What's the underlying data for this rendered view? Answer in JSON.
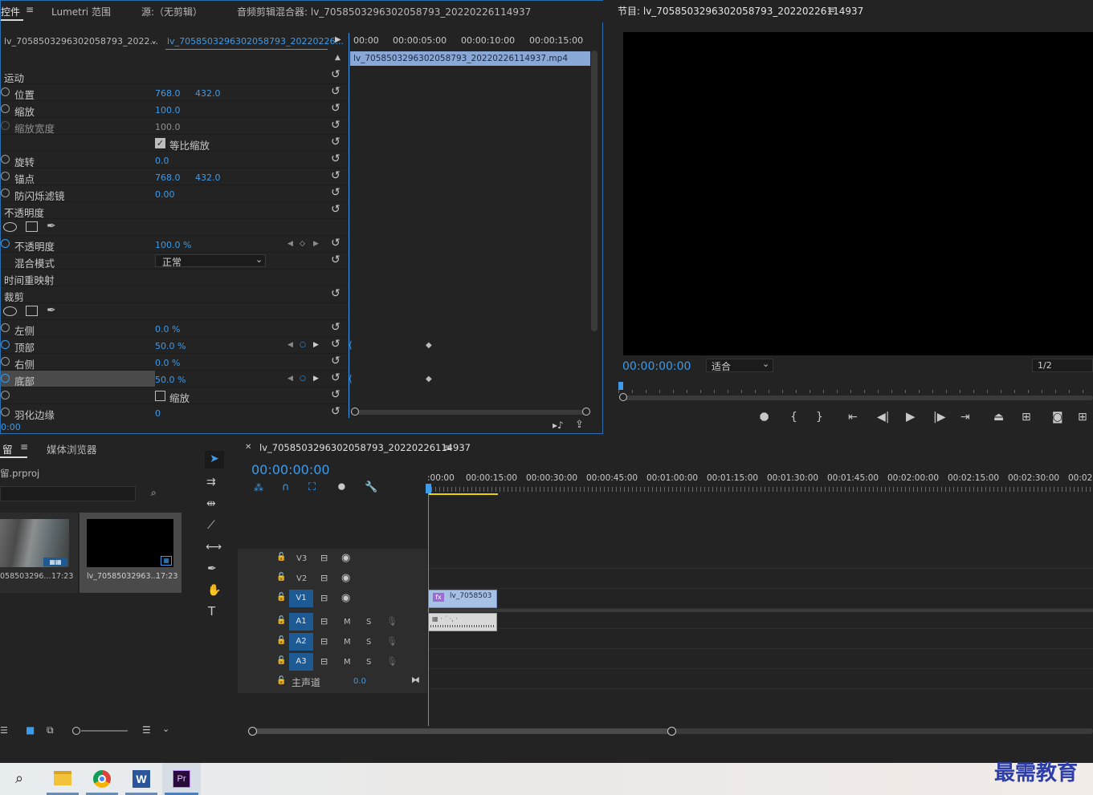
{
  "source_tabs": {
    "effect_controls": "控件",
    "lumetri": "Lumetri 范围",
    "source": "源:（无剪辑）",
    "audio_mixer": "音频剪辑混合器: lv_7058503296302058793_20220226114937"
  },
  "effect_controls": {
    "master_clip": "lv_705850329630205​8793_2022...",
    "sequence_clip": "lv_7058503296302058793_20220226...",
    "ruler": [
      "00:00",
      "00:00:05:00",
      "00:00:10:00",
      "00:00:15:00"
    ],
    "clip_bar": "lv_7058503296302058793_20220226114937.mp4",
    "motion": "运动",
    "position_label": "位置",
    "position_x": "768.0",
    "position_y": "432.0",
    "scale_label": "缩放",
    "scale_value": "100.0",
    "scale_width_label": "缩放宽度",
    "scale_width_value": "100.0",
    "uniform_scale": "等比缩放",
    "rotation_label": "旋转",
    "rotation_value": "0.0",
    "anchor_label": "锚点",
    "anchor_x": "768.0",
    "anchor_y": "432.0",
    "flicker_label": "防闪烁滤镜",
    "flicker_value": "0.00",
    "opacity_section": "不透明度",
    "opacity_label": "不透明度",
    "opacity_value": "100.0 %",
    "blend_label": "混合模式",
    "blend_value": "正常",
    "time_remap": "时间重映射",
    "crop": "裁剪",
    "left_label": "左侧",
    "left_value": "0.0 %",
    "top_label": "顶部",
    "top_value": "50.0 %",
    "right_label": "右侧",
    "right_value": "0.0 %",
    "bottom_label": "底部",
    "bottom_value": "50.0 %",
    "zoom_label": "缩放",
    "feather_label": "羽化边缘",
    "feather_value": "0",
    "timecode": "0:00"
  },
  "program": {
    "title": "节目: lv_7058503296302058793_20220226114937",
    "timecode": "00:00:00:00",
    "fit": "适合",
    "resolution": "1/2"
  },
  "project": {
    "tab_project": "留",
    "tab_media": "媒体浏览器",
    "file": "留.prproj",
    "items": [
      {
        "name": "058503296...",
        "duration": "17:23"
      },
      {
        "name": "lv_70585032963...",
        "duration": "17:23"
      }
    ]
  },
  "timeline": {
    "title": "lv_7058503296302058793_20220226114937",
    "timecode": "00:00:00:00",
    "ruler": [
      ":00:00",
      "00:00:15:00",
      "00:00:30:00",
      "00:00:45:00",
      "00:01:00:00",
      "00:01:15:00",
      "00:01:30:00",
      "00:01:45:00",
      "00:02:00:00",
      "00:02:15:00",
      "00:02:30:00",
      "00:02:"
    ],
    "video_tracks": [
      "V3",
      "V2",
      "V1"
    ],
    "audio_tracks": [
      "A1",
      "A2",
      "A3"
    ],
    "mute": "M",
    "solo": "S",
    "master_label": "主声道",
    "master_value": "0.0",
    "video_clip": "lv_7058503",
    "fx": "fx"
  },
  "watermark": "最需教育"
}
